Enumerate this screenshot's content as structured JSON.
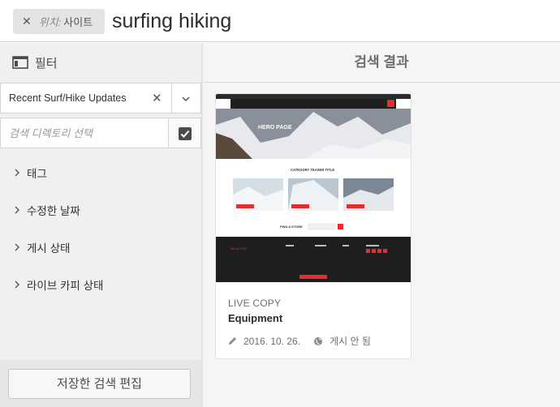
{
  "search": {
    "location_tag": {
      "key": "위치:",
      "value": "사이트"
    },
    "query": "surfing hiking"
  },
  "filter_rail": {
    "title": "필터",
    "saved_search": "Recent Surf/Hike Updates",
    "directory_placeholder": "검색 디렉토리 선택",
    "facets": [
      {
        "label": "태그"
      },
      {
        "label": "수정한 날짜"
      },
      {
        "label": "게시 상태"
      },
      {
        "label": "라이브 카피 상태"
      }
    ],
    "edit_saved_search": "저장한 검색 편집"
  },
  "results": {
    "title": "검색 결과",
    "cards": [
      {
        "type_label": "LIVE COPY",
        "title": "Equipment",
        "modified": "2016. 10. 26.",
        "status": "게시 안 됨",
        "thumbnail": {
          "brand": "WE.ACTIVE",
          "hero_title": "HERO PAGE",
          "teaser_title": "CATEGORY TEASER TITLE",
          "find_store": "FIND A STORE"
        }
      }
    ]
  },
  "colors": {
    "accent_red": "#e42e2e",
    "rail_bg": "#f0f0f0",
    "results_bg": "#f5f5f5"
  }
}
